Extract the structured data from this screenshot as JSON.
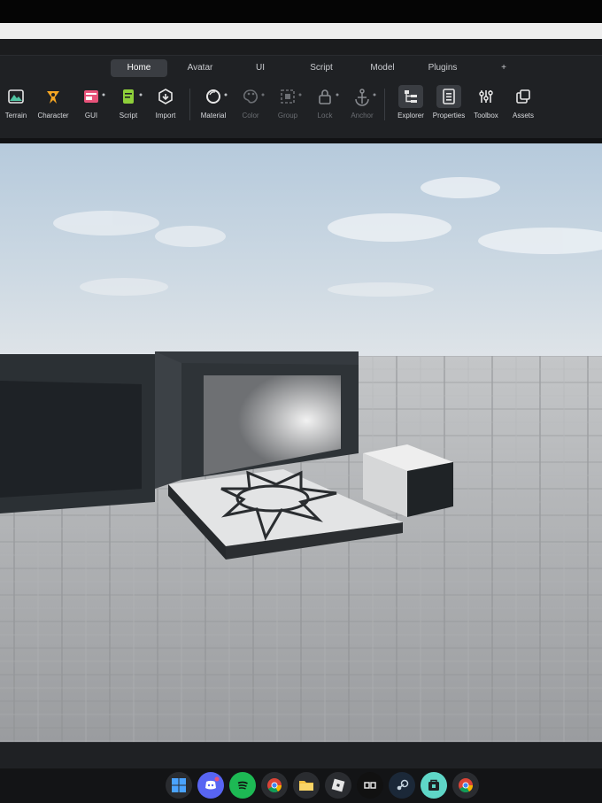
{
  "tabs": [
    {
      "label": "Home",
      "active": true
    },
    {
      "label": "Avatar",
      "active": false
    },
    {
      "label": "UI",
      "active": false
    },
    {
      "label": "Script",
      "active": false
    },
    {
      "label": "Model",
      "active": false
    },
    {
      "label": "Plugins",
      "active": false
    },
    {
      "label": "+",
      "active": false
    }
  ],
  "toolbar": {
    "terrain": "Terrain",
    "character": "Character",
    "gui": "GUI",
    "script": "Script",
    "import": "Import",
    "material": "Material",
    "color": "Color",
    "group": "Group",
    "lock": "Lock",
    "anchor": "Anchor",
    "explorer": "Explorer",
    "properties": "Properties",
    "toolbox": "Toolbox",
    "assets": "Assets"
  },
  "icons": {
    "terrain": "terrain-icon",
    "character": "character-icon",
    "gui": "gui-icon",
    "script": "script-icon",
    "import": "import-icon",
    "material": "material-icon",
    "color": "color-palette-icon",
    "group": "group-icon",
    "lock": "lock-icon",
    "anchor": "anchor-icon",
    "explorer": "explorer-icon",
    "properties": "properties-icon",
    "toolbox": "toolbox-icon",
    "assets": "assets-icon"
  },
  "colors": {
    "accent_orange": "#f5a623",
    "accent_green": "#8ecf3a",
    "accent_pink": "#e8537a",
    "ribbon_bg": "#1f2124",
    "sky_top": "#bccfe0",
    "ground": "#a9abad"
  },
  "taskbar_apps": [
    "windows-start-icon",
    "discord-icon",
    "spotify-icon",
    "chrome-icon",
    "file-explorer-icon",
    "roblox-icon",
    "roblox-studio-icon",
    "steam-icon",
    "store-icon",
    "chrome-alt-icon"
  ]
}
